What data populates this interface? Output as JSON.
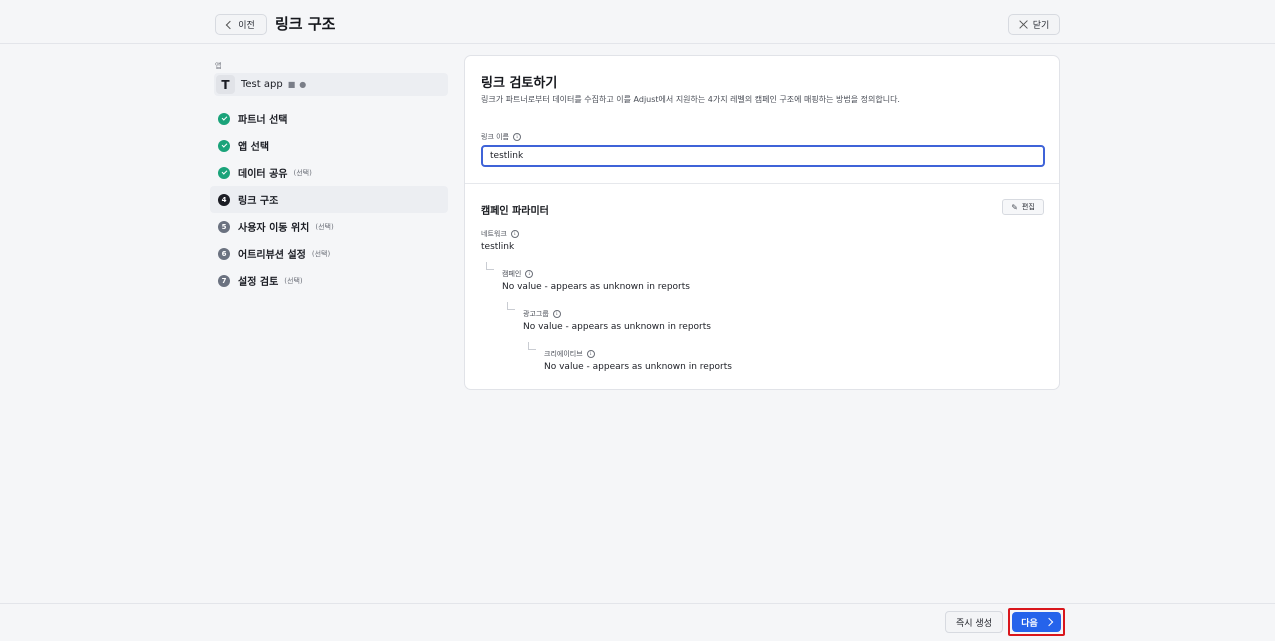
{
  "header": {
    "back_label": "이전",
    "title": "링크 구조",
    "close_label": "닫기"
  },
  "sidebar": {
    "app_section_label": "앱",
    "app": {
      "avatar_letter": "T",
      "name": "Test app",
      "platform_icons": [
        "android-icon",
        "apple-icon"
      ]
    },
    "steps": [
      {
        "number": "1",
        "label": "파트너 선택",
        "optional": "",
        "state": "done"
      },
      {
        "number": "2",
        "label": "앱 선택",
        "optional": "",
        "state": "done"
      },
      {
        "number": "3",
        "label": "데이터 공유",
        "optional": "(선택)",
        "state": "done"
      },
      {
        "number": "4",
        "label": "링크 구조",
        "optional": "",
        "state": "current"
      },
      {
        "number": "5",
        "label": "사용자 이동 위치",
        "optional": "(선택)",
        "state": "todo"
      },
      {
        "number": "6",
        "label": "어트리뷰션 설정",
        "optional": "(선택)",
        "state": "todo"
      },
      {
        "number": "7",
        "label": "설정 검토",
        "optional": "(선택)",
        "state": "todo"
      }
    ]
  },
  "card": {
    "title": "링크 검토하기",
    "description": "링크가 파트너로부터 데이터를 수집하고 이를 Adjust에서 지원하는 4가지 레벨의 캠페인 구조에 매핑하는 방법을 정의합니다.",
    "link_name_label": "링크 이름",
    "link_name_value": "testlink",
    "campaign_params_title": "캠페인 파라미터",
    "edit_label": "편집",
    "params": {
      "network": {
        "label": "네트워크",
        "value": "testlink"
      },
      "campaign": {
        "label": "캠페인",
        "value": "No value - appears as unknown in reports"
      },
      "adgroup": {
        "label": "광고그룹",
        "value": "No value - appears as unknown in reports"
      },
      "creative": {
        "label": "크리에이티브",
        "value": "No value - appears as unknown in reports"
      }
    }
  },
  "footer": {
    "instant_create_label": "즉시 생성",
    "next_label": "다음"
  },
  "colors": {
    "accent": "#2563eb",
    "done": "#1aa37a",
    "highlight": "#d9161c"
  }
}
